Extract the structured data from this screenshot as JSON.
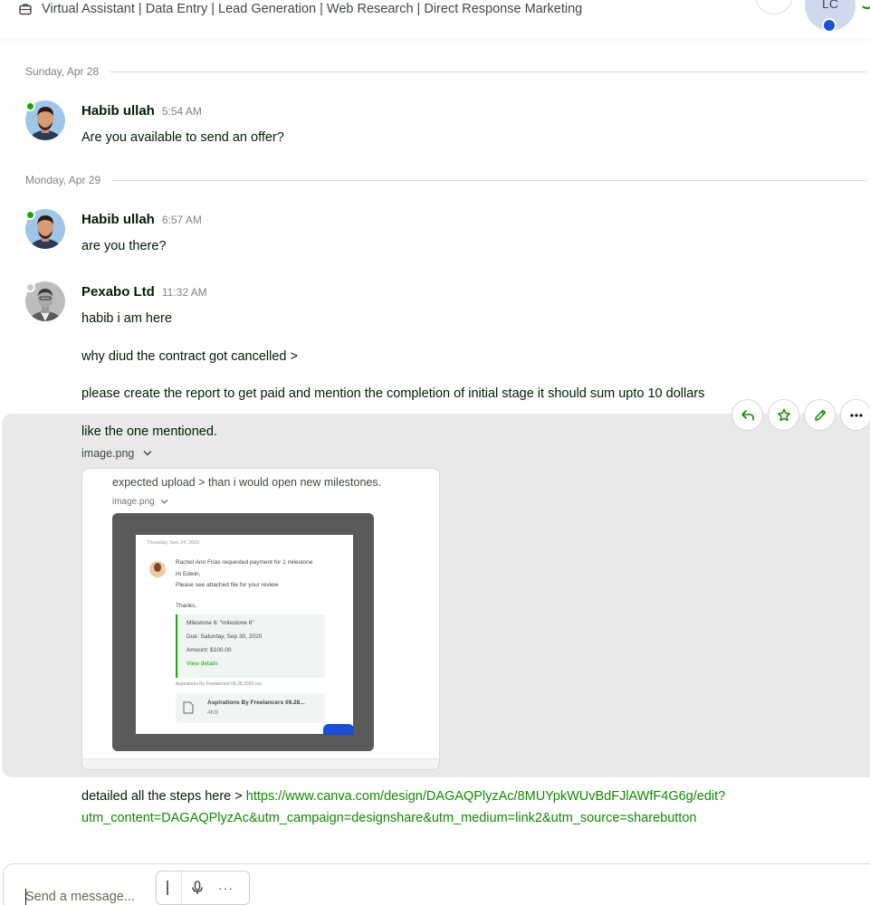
{
  "header": {
    "title": "Virtual Assistant | Data Entry | Lead Generation | Web Research | Direct Response Marketing",
    "avatar_initials": "LC"
  },
  "day_separators": [
    {
      "label": "Sunday, Apr 28"
    },
    {
      "label": "Monday, Apr 29"
    }
  ],
  "messages": [
    {
      "author": "Habib ullah",
      "time": "5:54 AM",
      "status": "online",
      "lines": [
        "Are you available to send an offer?"
      ]
    },
    {
      "author": "Habib ullah",
      "time": "6:57 AM",
      "status": "online",
      "lines": [
        "are you there?"
      ]
    },
    {
      "author": "Pexabo Ltd",
      "time": "11:32 AM",
      "status": "offline",
      "lines": [
        "habib i am here",
        "why diud the contract got cancelled >",
        "please create the report to get paid and mention the completion of initial stage it should sum upto 10 dollars",
        "like the one mentioned."
      ]
    }
  ],
  "attachment": {
    "filename": "image.png",
    "preview_caption": "expected upload > than i would open new milestones.",
    "preview_filename": "image.png",
    "inner_screenshot": {
      "date": "Thursday, Sep 24, 2020",
      "request_line": "Rachel Ann Frias requested payment for 1 milestone",
      "greeting": "Hi Edwin,",
      "note": "Please see attached file for your review",
      "thanks": "Thanks,",
      "milestone": "Milestone 6: \"milestone 6\"",
      "due": "Due: Saturday, Sep 30, 2020",
      "amount": "Amount: $100.00",
      "view_details": "View details",
      "file_label": "Aspirations By Freelancers 09.28.2020.csv",
      "file_name": "Aspirations By Freelancers 09.28...",
      "file_size": "4KB"
    }
  },
  "last_message": {
    "prefix": "detailed all the steps here > ",
    "link_line1": "https://www.canva.com/design/DAGAQPlyzAc/8MUYpkWUvBdFJlAWfF4G6g/edit?",
    "link_line2": "utm_content=DAGAQPlyzAc&utm_campaign=designshare&utm_medium=link2&utm_source=sharebutton"
  },
  "message_actions": [
    "reply-icon",
    "star-icon",
    "edit-icon",
    "more-icon"
  ],
  "composer": {
    "placeholder": "Send a message...",
    "more_label": "···"
  },
  "colors": {
    "accent_green": "#108a00",
    "online": "#14a800",
    "hover_bg": "#e9e9e9",
    "notification_blue": "#1d4fd6"
  }
}
